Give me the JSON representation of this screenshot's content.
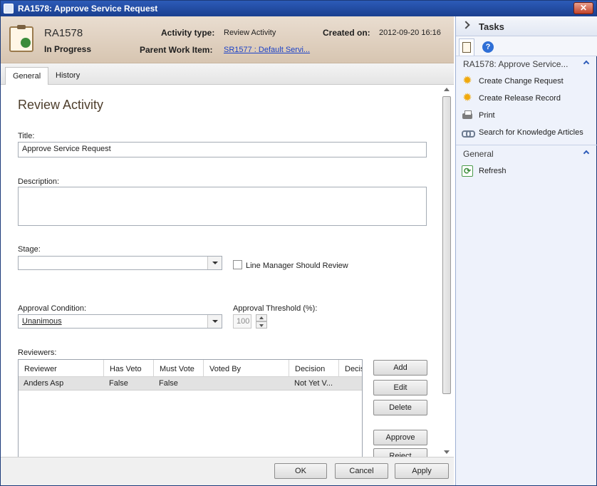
{
  "window": {
    "title": "RA1578: Approve Service Request",
    "close_glyph": "✕"
  },
  "header": {
    "id": "RA1578",
    "status": "In Progress",
    "activity_type_label": "Activity type:",
    "activity_type_value": "Review Activity",
    "created_on_label": "Created on:",
    "created_on_value": "2012-09-20 16:16",
    "parent_label": "Parent Work Item:",
    "parent_value": "SR1577 : Default Servi..."
  },
  "tabs": [
    {
      "label": "General"
    },
    {
      "label": "History"
    }
  ],
  "form": {
    "section_title": "Review Activity",
    "title_label": "Title:",
    "title_value": "Approve Service Request",
    "description_label": "Description:",
    "description_value": "",
    "stage_label": "Stage:",
    "stage_value": "",
    "line_manager_label": "Line Manager Should Review",
    "approval_condition_label": "Approval Condition:",
    "approval_condition_value": "Unanimous",
    "approval_threshold_label": "Approval Threshold (%):",
    "approval_threshold_value": "100",
    "reviewers_label": "Reviewers:"
  },
  "reviewers": {
    "columns": [
      "Reviewer",
      "Has Veto",
      "Must Vote",
      "Voted By",
      "Decision",
      "Decis"
    ],
    "rows": [
      {
        "reviewer": "Anders Asp",
        "has_veto": "False",
        "must_vote": "False",
        "voted_by": "",
        "decision": "Not Yet V..."
      }
    ]
  },
  "reviewer_buttons": {
    "add": "Add",
    "edit": "Edit",
    "delete": "Delete",
    "approve": "Approve",
    "reject": "Reject"
  },
  "footer": {
    "ok": "OK",
    "cancel": "Cancel",
    "apply": "Apply"
  },
  "tasks": {
    "title": "Tasks",
    "section1_title": "RA1578: Approve Service...",
    "items": [
      "Create Change Request",
      "Create Release Record",
      "Print",
      "Search for Knowledge Articles"
    ],
    "section2_title": "General",
    "general_items": [
      "Refresh"
    ]
  }
}
